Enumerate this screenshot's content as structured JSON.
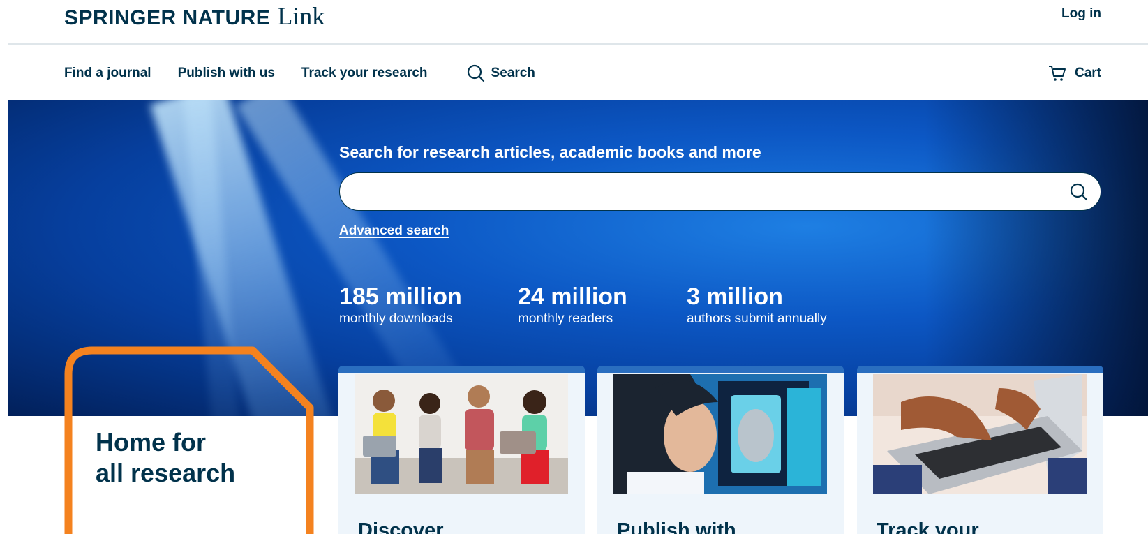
{
  "header": {
    "brand": "SPRINGER NATURE",
    "brand_suffix": "Link",
    "login_label": "Log in"
  },
  "nav": {
    "items": [
      {
        "label": "Find a journal"
      },
      {
        "label": "Publish with us"
      },
      {
        "label": "Track your research"
      }
    ],
    "search_label": "Search",
    "cart_label": "Cart"
  },
  "hero": {
    "heading": "Search for research articles, academic books and more",
    "search_value": "",
    "advanced_search_label": "Advanced search",
    "stats": [
      {
        "value": "185 million",
        "label": "monthly downloads"
      },
      {
        "value": "24 million",
        "label": "monthly readers"
      },
      {
        "value": "3 million",
        "label": "authors submit annually"
      }
    ]
  },
  "tagline": {
    "line1": "Home for",
    "line2": "all research"
  },
  "cards": [
    {
      "title": "Discover",
      "image_icon": "people-with-laptops-photo"
    },
    {
      "title": "Publish with",
      "image_icon": "researcher-with-screens-photo"
    },
    {
      "title": "Track your",
      "image_icon": "hands-typing-laptop-photo"
    }
  ],
  "colors": {
    "brand_navy": "#01324b",
    "hero_blue": "#0c57c4",
    "accent_orange": "#f4821f",
    "card_bg": "#eef5fb"
  }
}
